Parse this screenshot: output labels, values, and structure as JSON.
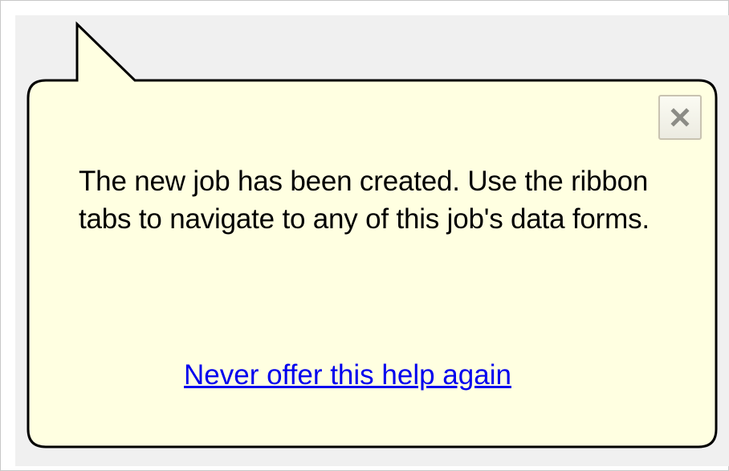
{
  "balloon": {
    "message": "The new job has been created. Use the ribbon tabs to navigate to any of this job's data forms.",
    "link_label": "Never offer this help again",
    "close_icon": "close-icon",
    "colors": {
      "balloon_fill": "#ffffe1",
      "balloon_border": "#000000",
      "link": "#0000ee",
      "backdrop": "#f0f0f0"
    }
  }
}
